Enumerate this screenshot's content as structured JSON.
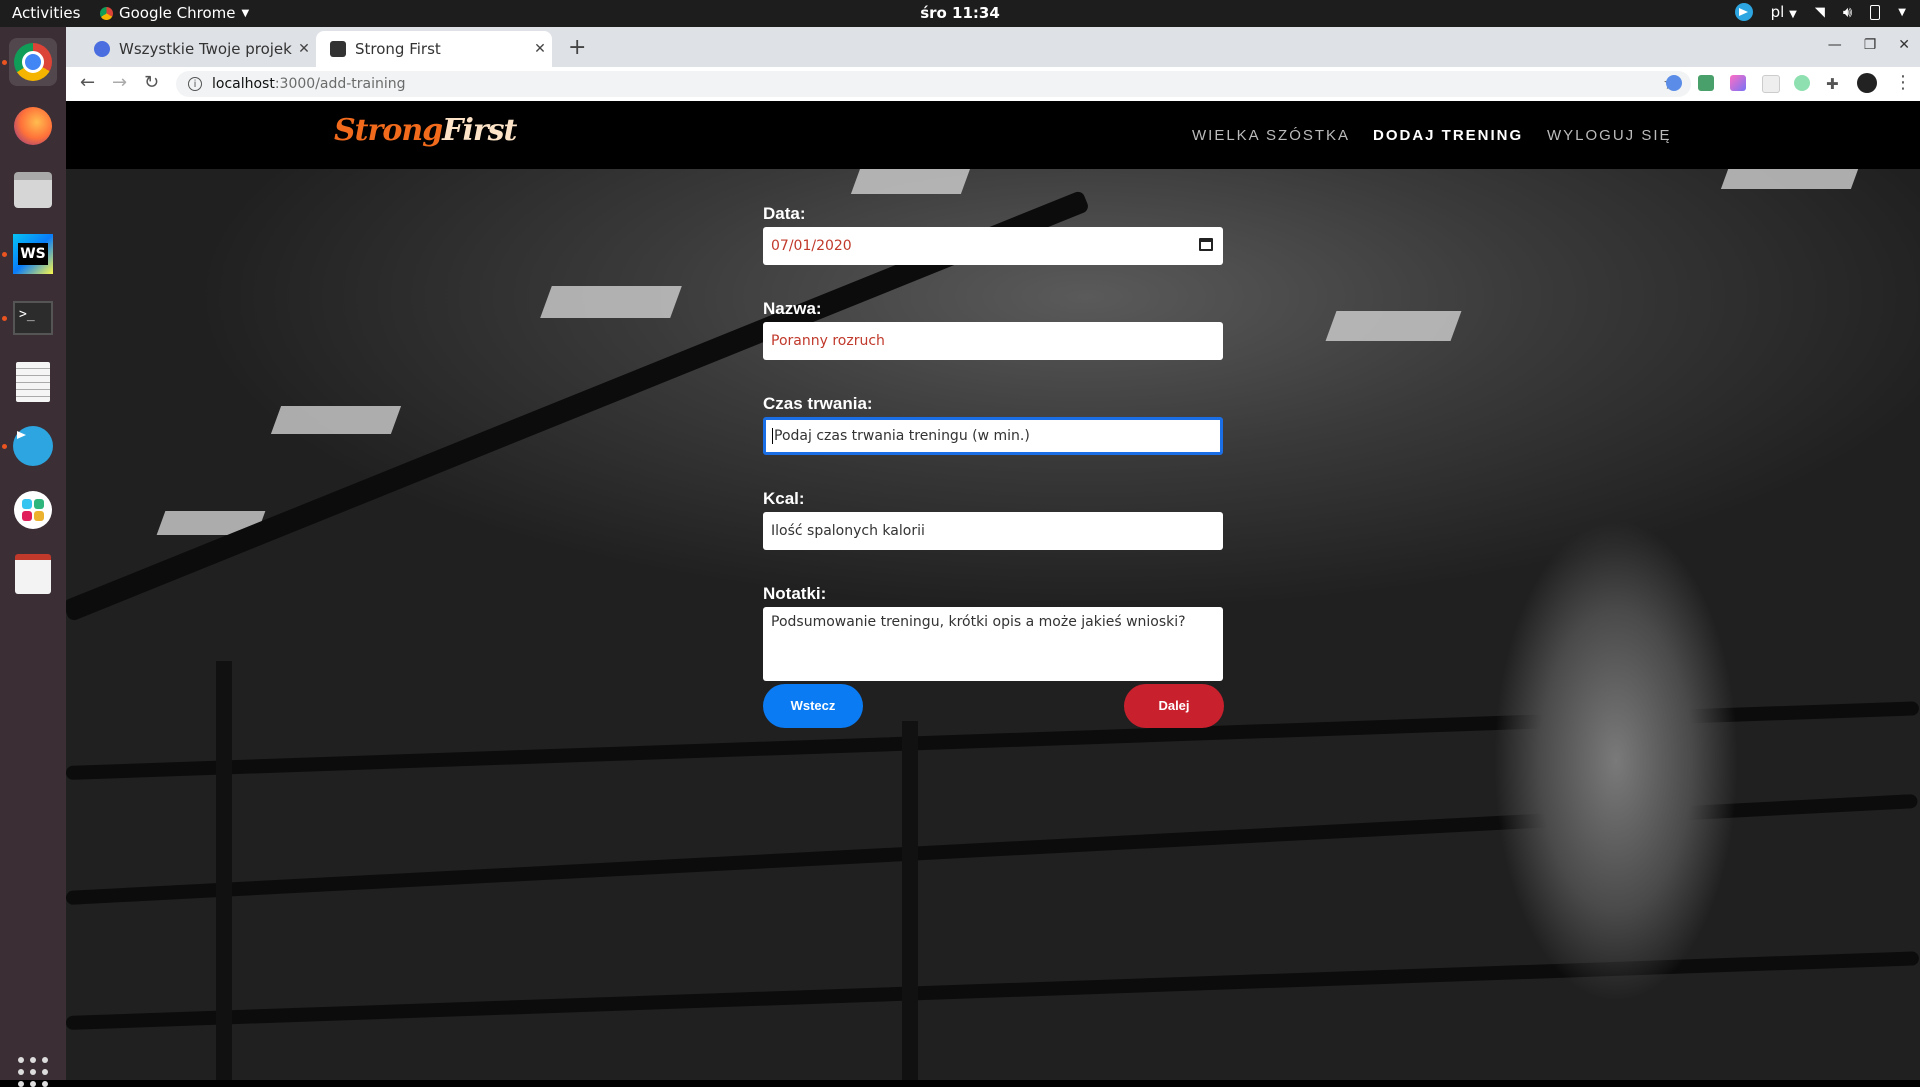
{
  "os": {
    "activities": "Activities",
    "app_name": "Google Chrome",
    "clock": "śro 11:34",
    "lang": "pl"
  },
  "browser": {
    "tabs": [
      {
        "title": "Wszystkie Twoje projekty",
        "active": false
      },
      {
        "title": "Strong First",
        "active": true
      }
    ],
    "url_host": "localhost",
    "url_path": ":3000/add-training"
  },
  "site": {
    "logo_part1": "Strong",
    "logo_part2": "First",
    "nav": [
      {
        "label": "WIELKA SZÓSTKA",
        "active": false
      },
      {
        "label": "DODAJ TRENING",
        "active": true
      },
      {
        "label": "WYLOGUJ SIĘ",
        "active": false
      }
    ]
  },
  "form": {
    "date_label": "Data:",
    "date_value": "07/01/2020",
    "name_label": "Nazwa:",
    "name_value": "Poranny rozruch",
    "duration_label": "Czas trwania:",
    "duration_placeholder": "Podaj czas trwania treningu (w min.)",
    "kcal_label": "Kcal:",
    "kcal_placeholder": "Ilość spalonych kalorii",
    "notes_label": "Notatki:",
    "notes_placeholder": "Podsumowanie treningu, krótki opis a może jakieś wnioski?",
    "back_label": "Wstecz",
    "next_label": "Dalej"
  },
  "colors": {
    "logo_orange": "#f26b1d",
    "back_button": "#0a7bf3",
    "next_button": "#c9202e",
    "focus_border": "#1b6fe6"
  }
}
